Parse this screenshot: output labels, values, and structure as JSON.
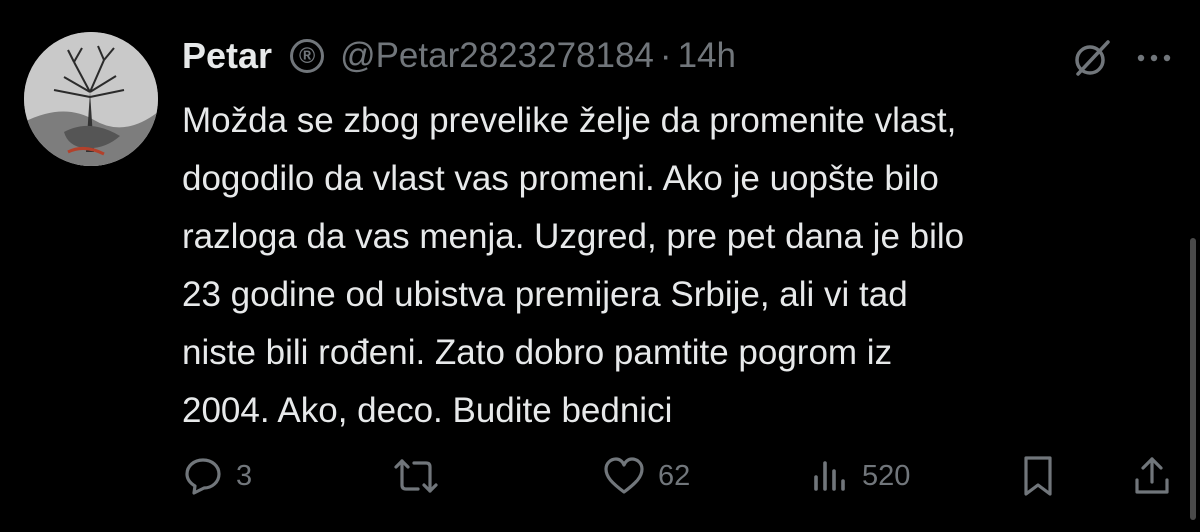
{
  "tweet": {
    "author": {
      "name": "Petar",
      "handle": "@Petar2823278184",
      "badge": "®"
    },
    "separator": "·",
    "time": "14h",
    "lines": [
      "Možda se zbog prevelike želje da promenite vlast,",
      "dogodilo da vlast vas promeni. Ako je uopšte bilo",
      "razloga da vas menja. Uzgred, pre pet dana je bilo",
      "23 godine od ubistva premijera Srbije, ali vi tad",
      "niste bili rođeni. Zato dobro pamtite pogrom iz",
      "2004. Ako, deco. Budite bednici"
    ],
    "stats": {
      "replies": "3",
      "retweets": "",
      "likes": "62",
      "views": "520"
    }
  },
  "icons": {
    "header": [
      "grok-icon",
      "more-icon"
    ],
    "actions": [
      "reply-icon",
      "retweet-icon",
      "like-icon",
      "views-icon",
      "bookmark-icon",
      "share-icon"
    ]
  },
  "colors": {
    "background": "#000000",
    "text": "#e7e9ea",
    "muted": "#71767b"
  }
}
